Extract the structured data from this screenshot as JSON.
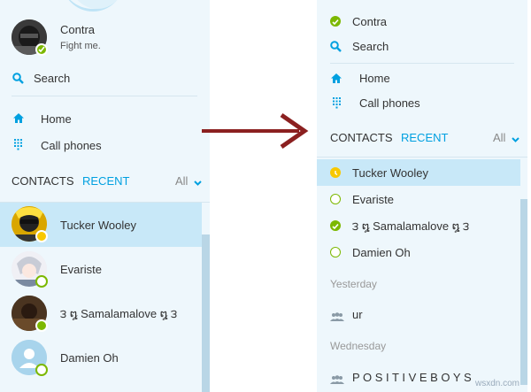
{
  "left": {
    "profile": {
      "name": "Contra",
      "mood": "Fight me."
    },
    "search_label": "Search",
    "nav": [
      {
        "label": "Home",
        "icon": "home-icon"
      },
      {
        "label": "Call phones",
        "icon": "dialpad-icon"
      }
    ],
    "tabs": {
      "contacts": "CONTACTS",
      "recent": "RECENT",
      "filter": "All"
    },
    "list": [
      {
        "name": "Tucker Wooley",
        "status": "away",
        "selected": true
      },
      {
        "name": "Evariste",
        "status": "offline"
      },
      {
        "name": "౩ ໘ Samalamalove ໘ ౩",
        "status": "online"
      },
      {
        "name": "Damien Oh",
        "status": "offline"
      }
    ]
  },
  "arrow": {
    "icon": "right-arrow-icon",
    "color": "#8b2020"
  },
  "right": {
    "status_label": "Contra",
    "search_label": "Search",
    "nav": [
      {
        "label": "Home",
        "icon": "home-icon"
      },
      {
        "label": "Call phones",
        "icon": "dialpad-icon"
      }
    ],
    "tabs": {
      "contacts": "CONTACTS",
      "recent": "RECENT",
      "filter": "All"
    },
    "list": [
      {
        "name": "Tucker Wooley",
        "status": "away",
        "selected": true
      },
      {
        "name": "Evariste",
        "status": "offline"
      },
      {
        "name": "౩ ໘ Samalamalove ໘ ౩",
        "status": "online"
      },
      {
        "name": "Damien Oh",
        "status": "offline"
      }
    ],
    "sections": [
      {
        "heading": "Yesterday",
        "group": "ur"
      },
      {
        "heading": "Wednesday",
        "group": "P O S I T I V E  B O Y S"
      }
    ]
  },
  "watermark": "wsxdn.com",
  "colors": {
    "accent": "#00a0e0",
    "online": "#7cb800",
    "away": "#f8c800",
    "selected": "#c8e8f8",
    "panel": "#eef7fc"
  }
}
